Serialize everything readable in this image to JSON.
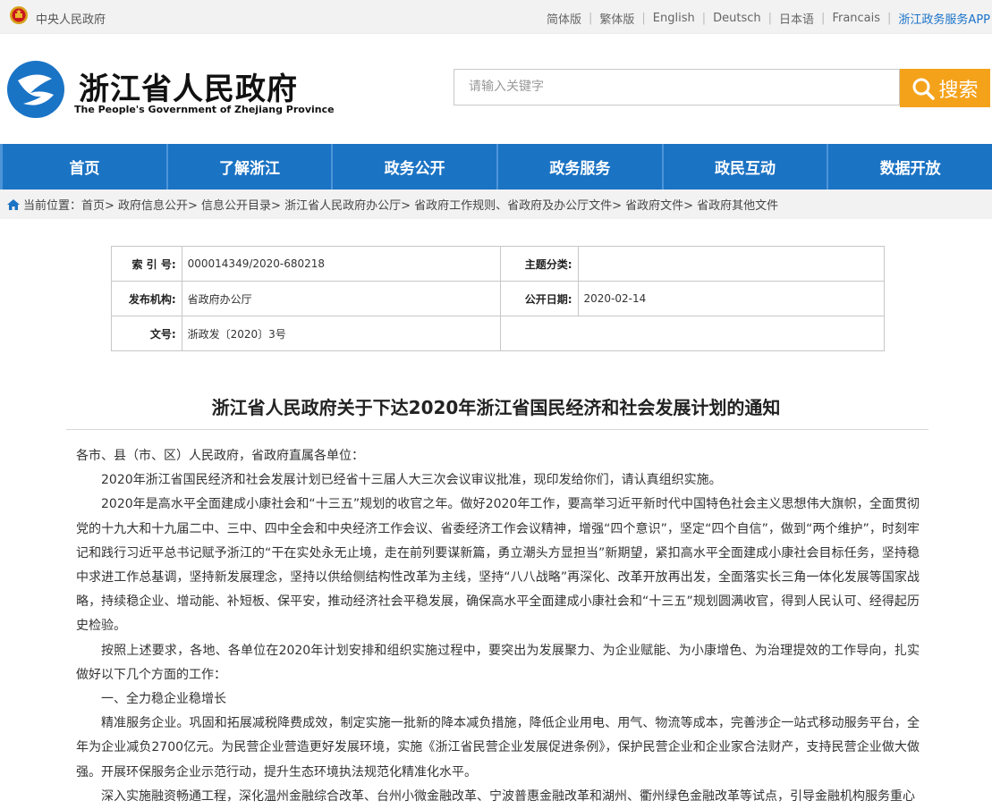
{
  "topbar": {
    "central_gov": "中央人民政府",
    "links": [
      "简体版",
      "繁体版",
      "English",
      "Deutsch",
      "日本语",
      "Francais"
    ],
    "app_link": "浙江政务服务APP"
  },
  "header": {
    "title": "浙江省人民政府",
    "subtitle": "The People's Government of Zhejiang Province"
  },
  "search": {
    "placeholder": "请输入关键字",
    "button_label": "搜索"
  },
  "nav": [
    "首页",
    "了解浙江",
    "政务公开",
    "政务服务",
    "政民互动",
    "数据开放"
  ],
  "breadcrumb": "当前位置：首页> 政府信息公开> 信息公开目录> 浙江省人民政府办公厅> 省政府工作规则、省政府及办公厅文件> 省政府文件> 省政府其他文件",
  "meta": {
    "index_label": "索 引 号:",
    "index_value": "000014349/2020-680218",
    "topic_label": "主题分类:",
    "topic_value": "",
    "publisher_label": "发布机构:",
    "publisher_value": "省政府办公厅",
    "date_label": "公开日期:",
    "date_value": "2020-02-14",
    "docno_label": "文号:",
    "docno_value": "浙政发〔2020〕3号"
  },
  "article": {
    "title": "浙江省人民政府关于下达2020年浙江省国民经济和社会发展计划的通知",
    "paragraphs": [
      "各市、县（市、区）人民政府，省政府直属各单位：",
      "2020年浙江省国民经济和社会发展计划已经省十三届人大三次会议审议批准，现印发给你们，请认真组织实施。",
      "2020年是高水平全面建成小康社会和“十三五”规划的收官之年。做好2020年工作，要高举习近平新时代中国特色社会主义思想伟大旗帜，全面贯彻党的十九大和十九届二中、三中、四中全会和中央经济工作会议、省委经济工作会议精神，增强“四个意识”，坚定“四个自信”，做到“两个维护”，时刻牢记和践行习近平总书记赋予浙江的“干在实处永无止境，走在前列要谋新篇，勇立潮头方显担当”新期望，紧扣高水平全面建成小康社会目标任务，坚持稳中求进工作总基调，坚持新发展理念，坚持以供给侧结构性改革为主线，坚持“八八战略”再深化、改革开放再出发，全面落实长三角一体化发展等国家战略，持续稳企业、增动能、补短板、保平安，推动经济社会平稳发展，确保高水平全面建成小康社会和“十三五”规划圆满收官，得到人民认可、经得起历史检验。",
      "按照上述要求，各地、各单位在2020年计划安排和组织实施过程中，要突出为发展聚力、为企业赋能、为小康增色、为治理提效的工作导向，扎实做好以下几个方面的工作：",
      "一、全力稳企业稳增长",
      "精准服务企业。巩固和拓展减税降费成效，制定实施一批新的降本减负措施，降低企业用电、用气、物流等成本，完善涉企一站式移动服务平台，全年为企业减负2700亿元。为民营企业营造更好发展环境，实施《浙江省民营企业发展促进条例》，保护民营企业和企业家合法财产，支持民营企业做大做强。开展环保服务企业示范行动，提升生态环境执法规范化精准化水平。",
      "深入实施融资畅通工程，深化温州金融综合改革、台州小微金融改革、宁波普惠金融改革和湖州、衢州绿色金融改革等试点，引导金融机构服务重心"
    ]
  }
}
